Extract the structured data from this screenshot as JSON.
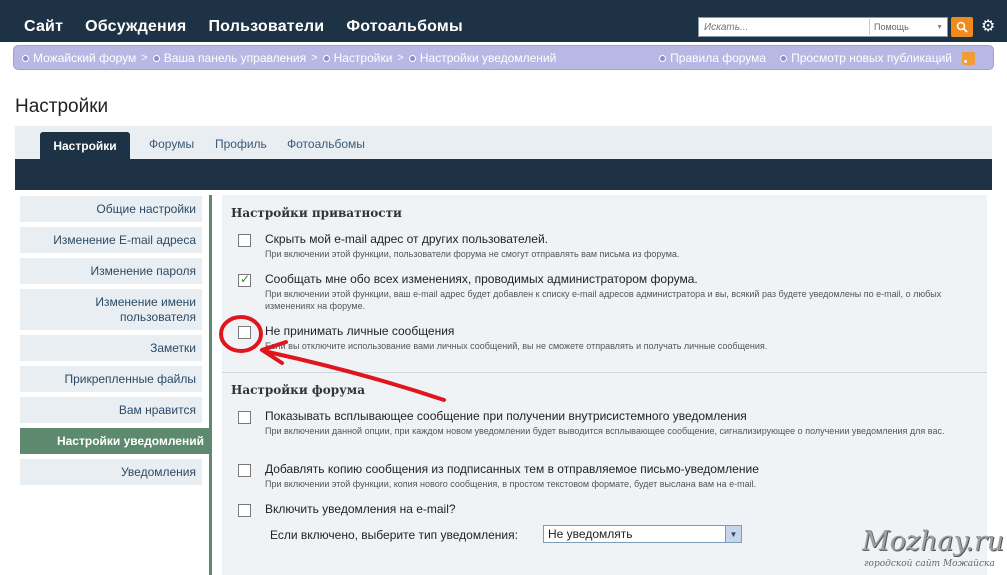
{
  "topnav": [
    "Сайт",
    "Обсуждения",
    "Пользователи",
    "Фотоальбомы"
  ],
  "search": {
    "placeholder": "Искать...",
    "scope": "Помощь"
  },
  "breadcrumb": [
    "Можайский форум",
    "Ваша панель управления",
    "Настройки",
    "Настройки уведомлений"
  ],
  "header_links": [
    "Правила форума",
    "Просмотр новых публикаций"
  ],
  "page_title": "Настройки",
  "tabs": {
    "active": "Настройки",
    "items": [
      "Форумы",
      "Профиль",
      "Фотоальбомы"
    ]
  },
  "sidebar": [
    "Общие настройки",
    "Изменение E-mail адреса",
    "Изменение пароля",
    "Изменение имени пользователя",
    "Заметки",
    "Прикрепленные файлы",
    "Вам нравится",
    "Настройки уведомлений",
    "Уведомления"
  ],
  "privacy": {
    "title": "Настройки приватности",
    "options": [
      {
        "label": "Скрыть мой e-mail адрес от других пользователей.",
        "desc": "При включении этой функции, пользователи форума не смогут отправлять вам письма из форума.",
        "checked": false
      },
      {
        "label": "Сообщать мне обо всех изменениях, проводимых администратором форума.",
        "desc": "При включении этой функции, ваш e-mail адрес будет добавлен к списку e-mail адресов администратора и вы, всякий раз будете уведомлены по e-mail, о любых изменениях на форуме.",
        "checked": true
      },
      {
        "label": "Не принимать личные сообщения",
        "desc": "Если вы отключите использование вами личных сообщений, вы не сможете отправлять и получать личные сообщения.",
        "checked": false
      }
    ]
  },
  "forum": {
    "title": "Настройки форума",
    "options": [
      {
        "label": "Показывать всплывающее сообщение при получении внутрисистемного уведомления",
        "desc": "При включении данной опции, при каждом новом уведомлении будет выводится всплывающее сообщение, сигнализирующее о получении уведомления для вас.",
        "checked": false
      },
      {
        "label": "Добавлять копию сообщения из подписанных тем в отправляемое письмо-уведомление",
        "desc": "При включении этой функции, копия нового сообщения, в простом текстовом формате, будет выслана вам на e-mail.",
        "checked": false
      },
      {
        "label": "Включить уведомления на e-mail?",
        "checked": false
      }
    ],
    "email_type_label": "Если включено, выберите тип уведомления:",
    "email_type_value": "Не уведомлять"
  },
  "watermark": {
    "main": "Mozhay.ru",
    "sub": "городской сайт Можайска"
  },
  "colors": {
    "nav_dark": "#1d3244",
    "crumb_bg": "#b8b8e4",
    "active_green": "#5d8a6e",
    "search_orange": "#f08a1c",
    "annotation_red": "#e0161e"
  }
}
